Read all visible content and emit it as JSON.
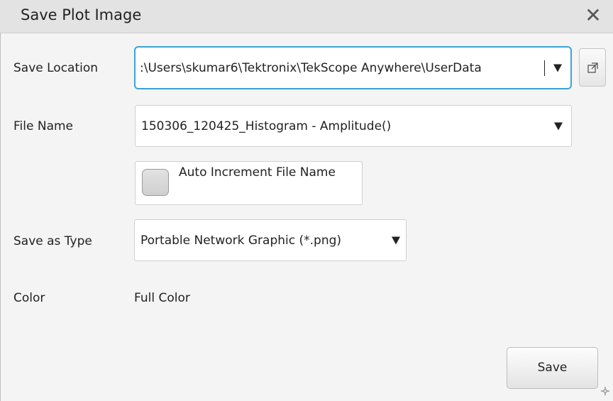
{
  "dialog": {
    "title": "Save Plot Image",
    "close_symbol": "✕"
  },
  "save_location": {
    "label": "Save Location",
    "value": ":\\Users\\skumar6\\Tektronix\\TekScope Anywhere\\UserData",
    "browse_icon": "external-link-icon"
  },
  "file_name": {
    "label": "File Name",
    "value": "150306_120425_Histogram - Amplitude()"
  },
  "auto_increment": {
    "label": "Auto Increment File Name",
    "checked": false
  },
  "save_as_type": {
    "label": "Save as Type",
    "value": "Portable Network Graphic (*.png)"
  },
  "color": {
    "label": "Color",
    "value": "Full Color"
  },
  "actions": {
    "save_label": "Save"
  },
  "colors": {
    "focus_border": "#3ba3d6",
    "titlebar_bg": "#e3e3e3",
    "dialog_bg": "#f4f4f4"
  }
}
